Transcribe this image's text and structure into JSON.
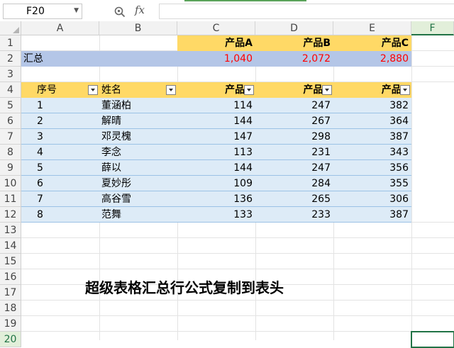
{
  "formula_bar": {
    "name_box": "F20",
    "fx_label": "fx",
    "formula": ""
  },
  "columns": [
    "A",
    "B",
    "C",
    "D",
    "E",
    "F"
  ],
  "rows": [
    "1",
    "2",
    "3",
    "4",
    "5",
    "6",
    "7",
    "8",
    "9",
    "10",
    "11",
    "12",
    "13",
    "14",
    "15",
    "16",
    "17",
    "18",
    "19",
    "20"
  ],
  "summary_header": [
    "产品A",
    "产品B",
    "产品C"
  ],
  "summary_row": {
    "label": "汇总",
    "values": [
      "1,040",
      "2,072",
      "2,880"
    ]
  },
  "table": {
    "headers": [
      "序号",
      "姓名",
      "产品A",
      "产品B",
      "产品C"
    ],
    "rows": [
      [
        "1",
        "董涵柏",
        "114",
        "247",
        "382"
      ],
      [
        "2",
        "解晴",
        "144",
        "267",
        "364"
      ],
      [
        "3",
        "邓灵槐",
        "147",
        "298",
        "387"
      ],
      [
        "4",
        "李念",
        "113",
        "231",
        "343"
      ],
      [
        "5",
        "薛以",
        "144",
        "247",
        "356"
      ],
      [
        "6",
        "夏妙彤",
        "109",
        "284",
        "355"
      ],
      [
        "7",
        "高谷雪",
        "136",
        "265",
        "306"
      ],
      [
        "8",
        "范舞",
        "133",
        "233",
        "387"
      ]
    ]
  },
  "caption": "超级表格汇总行公式复制到表头",
  "colors": {
    "header_fill": "#ffd966",
    "summary_fill": "#b4c6e7",
    "band_fill": "#ddebf7",
    "total_text": "#ff0000",
    "selection": "#217346"
  }
}
